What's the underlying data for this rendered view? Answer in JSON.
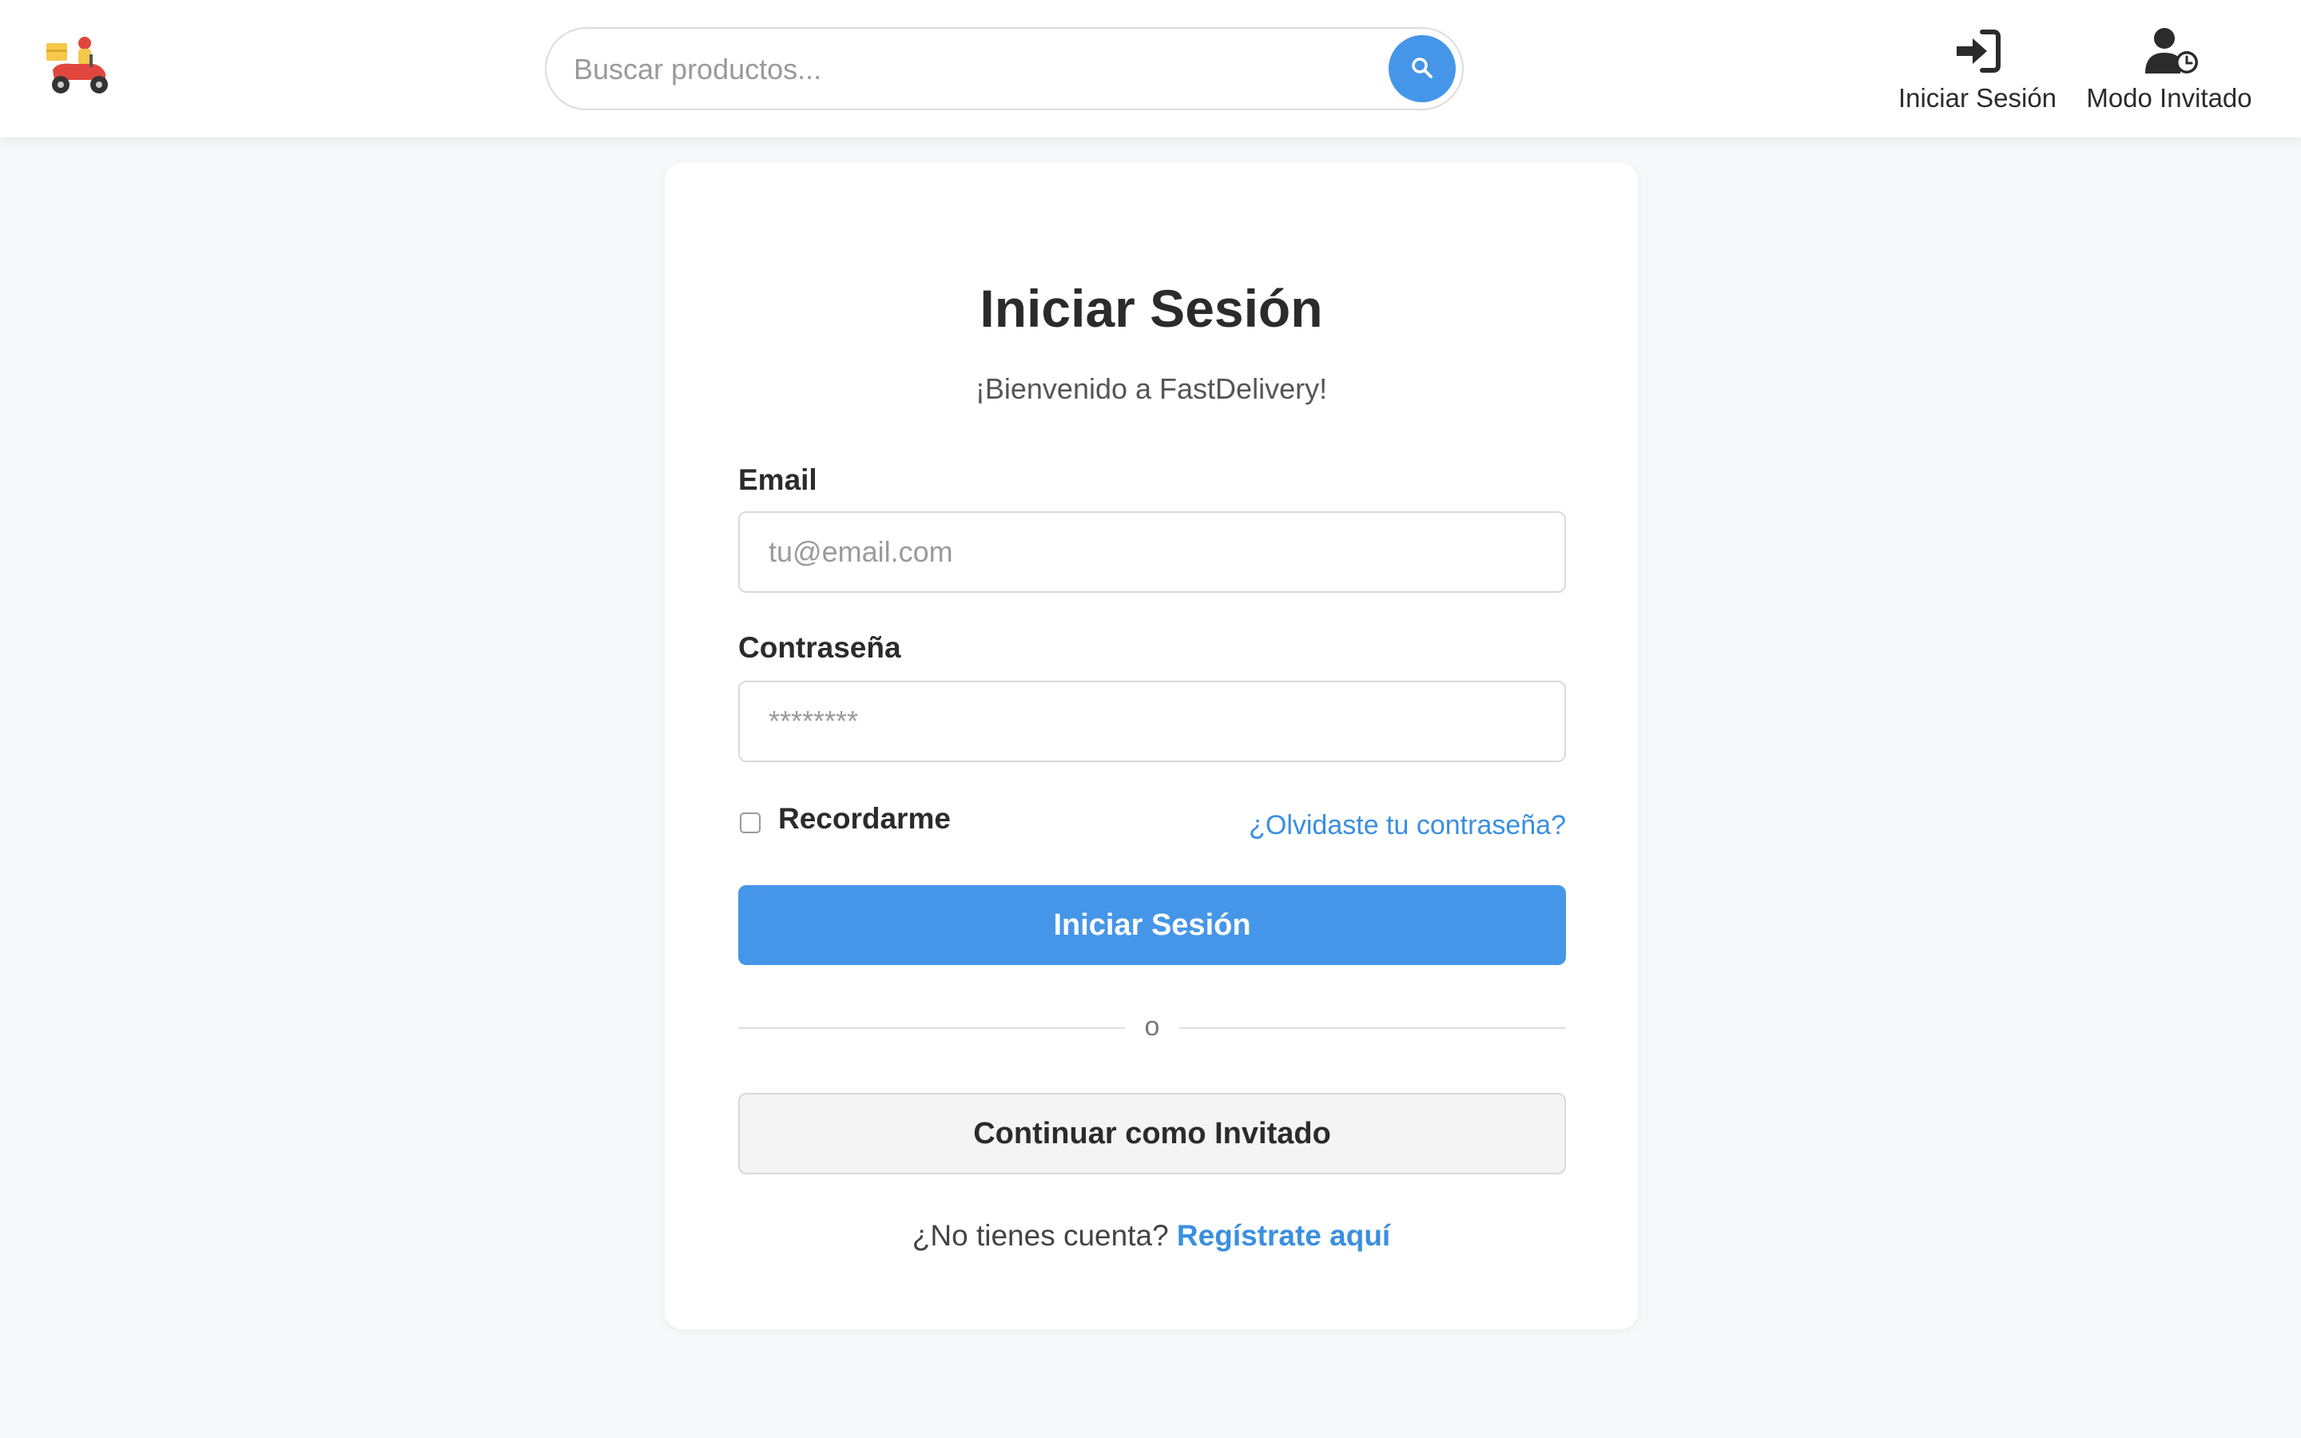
{
  "header": {
    "logo_icon": "delivery-scooter-icon",
    "search": {
      "placeholder": "Buscar productos...",
      "value": "",
      "icon": "search-icon"
    },
    "nav": {
      "login_label": "Iniciar Sesión",
      "login_icon": "sign-in-icon",
      "guest_label": "Modo Invitado",
      "guest_icon": "user-clock-icon"
    }
  },
  "login_card": {
    "title": "Iniciar Sesión",
    "subtitle": "¡Bienvenido a FastDelivery!",
    "email": {
      "label": "Email",
      "placeholder": "tu@email.com",
      "value": ""
    },
    "password": {
      "label": "Contraseña",
      "placeholder": "********",
      "value": ""
    },
    "remember_label": "Recordarme",
    "remember_checked": false,
    "forgot_link": "¿Olvidaste tu contraseña?",
    "submit_label": "Iniciar Sesión",
    "divider_text": "o",
    "guest_button": "Continuar como Invitado",
    "signup_prompt": "¿No tienes cuenta?",
    "signup_link": "Regístrate aquí"
  },
  "colors": {
    "accent": "#4596e8",
    "link": "#3a8fe0",
    "page_bg": "#f7f8fa",
    "text": "#2b2b2b"
  }
}
